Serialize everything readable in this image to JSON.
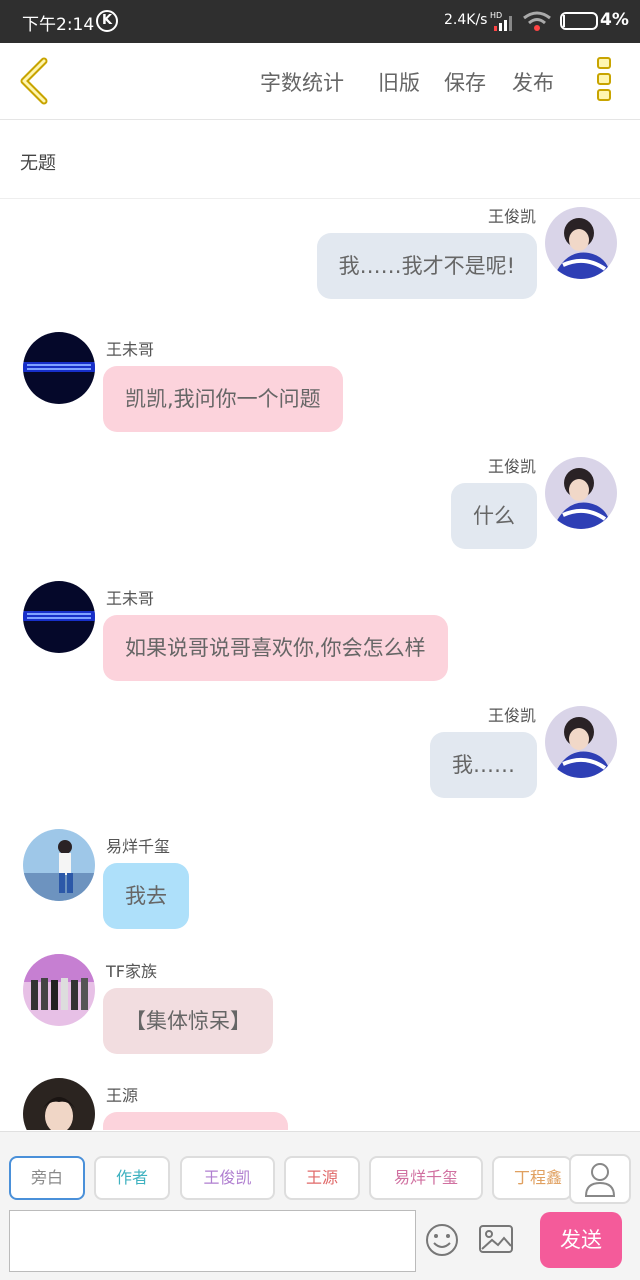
{
  "status_bar": {
    "time": "下午2:14",
    "k_badge": "K",
    "network_speed": "2.4K/s",
    "network_type": "HD",
    "battery_percent": "4%"
  },
  "top_bar": {
    "actions": [
      "字数统计",
      "旧版",
      "保存",
      "发布"
    ]
  },
  "document": {
    "title": "无题"
  },
  "messages": [
    {
      "side": "right",
      "name": "王俊凯",
      "text": "我……我才不是呢!",
      "bubble_color": "#e2e8f0",
      "avatar": "wang-junkai-avatar"
    },
    {
      "side": "left",
      "name": "王未哥",
      "text": "凯凯,我问你一个问题",
      "bubble_color": "#fcd3dc",
      "avatar": "neon-text-avatar"
    },
    {
      "side": "right",
      "name": "王俊凯",
      "text": "什么",
      "bubble_color": "#e2e8f0",
      "avatar": "wang-junkai-avatar"
    },
    {
      "side": "left",
      "name": "王未哥",
      "text": "如果说哥说哥喜欢你,你会怎么样",
      "bubble_color": "#fcd3dc",
      "avatar": "neon-text-avatar"
    },
    {
      "side": "right",
      "name": "王俊凯",
      "text": "我……",
      "bubble_color": "#e2e8f0",
      "avatar": "wang-junkai-avatar"
    },
    {
      "side": "left",
      "name": "易烊千玺",
      "text": "我去",
      "bubble_color": "#aee0fa",
      "avatar": "yi-yangqianxi-avatar"
    },
    {
      "side": "left",
      "name": "TF家族",
      "text": "【集体惊呆】",
      "bubble_color": "#f2dde0",
      "avatar": "tf-family-avatar"
    },
    {
      "side": "left",
      "name": "王源",
      "text": "",
      "bubble_color": "#fcd3dc",
      "avatar": "wang-yuan-avatar"
    }
  ],
  "role_chips": [
    {
      "label": "旁白",
      "color": "#8a8a8a",
      "active": true
    },
    {
      "label": "作者",
      "color": "#3fb2c0",
      "active": false
    },
    {
      "label": "王俊凯",
      "color": "#b07fd0",
      "active": false
    },
    {
      "label": "王源",
      "color": "#e06a6a",
      "active": false
    },
    {
      "label": "易烊千玺",
      "color": "#d070a0",
      "active": false
    },
    {
      "label": "丁程鑫",
      "color": "#e0a060",
      "active": false
    }
  ],
  "input": {
    "value": "",
    "placeholder": ""
  },
  "send_button": {
    "label": "发送",
    "color": "#f45b9a"
  },
  "colors": {
    "accent_yellow": "#c8a400",
    "send_pink": "#f45b9a"
  }
}
